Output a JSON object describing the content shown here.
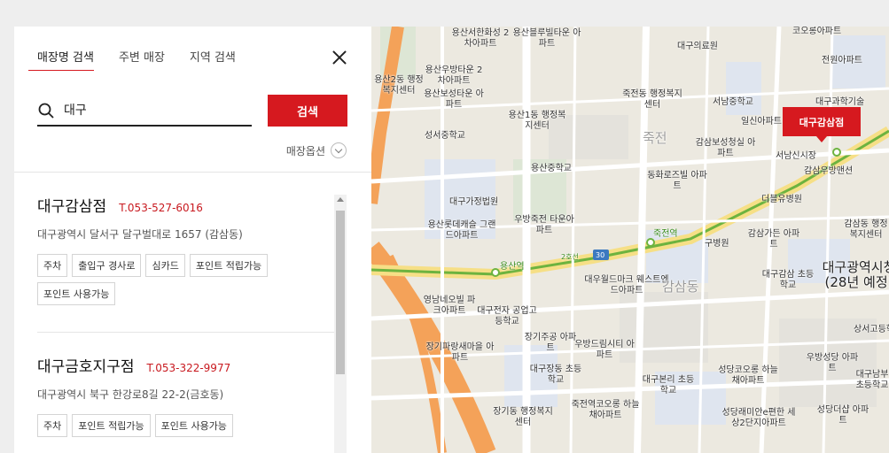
{
  "tabs": [
    {
      "label": "매장명 검색",
      "active": true
    },
    {
      "label": "주변 매장",
      "active": false
    },
    {
      "label": "지역 검색",
      "active": false
    }
  ],
  "search": {
    "value": "대구",
    "button_label": "검색"
  },
  "options": {
    "label": "매장옵션"
  },
  "stores": [
    {
      "name": "대구감삼점",
      "phone": "T.053-527-6016",
      "address": "대구광역시 달서구 달구벌대로 1657 (감삼동)",
      "tags": [
        "주차",
        "출입구 경사로",
        "심카드",
        "포인트 적립가능",
        "포인트 사용가능"
      ]
    },
    {
      "name": "대구금호지구점",
      "phone": "T.053-322-9977",
      "address": "대구광역시 북구 한강로8길 22-2(금호동)",
      "tags": [
        "주차",
        "포인트 적립가능",
        "포인트 사용가능"
      ]
    }
  ],
  "map": {
    "marker_label": "대구감삼점",
    "labels": [
      "용산서한화성 2차아파트",
      "용산블루빌타운 아파트",
      "대구의료원",
      "용산2동 행정복지센터",
      "용산우방타운 2차아파트",
      "용산보성타운 아파트",
      "성서중학교",
      "용산1동 행정복지센터",
      "죽전동 행정복지센터",
      "서남중학교",
      "대구과학기술",
      "일신아파트",
      "전원아파트",
      "코오롱아파트",
      "감삼보성청실 아파트",
      "서남신시장",
      "감삼우방맨션",
      "동화로즈빌 아파트",
      "더블유병원",
      "대구가정법원",
      "용산중학교",
      "우방죽전 타운아파트",
      "용산롯데캐슬 그랜드아파트",
      "용산역",
      "죽전역",
      "구병원",
      "감삼가든 아파트",
      "대구감삼 초등학교",
      "대구광역시청 (28년 예정)",
      "감삼동 행정복지센터",
      "대우월드마크 웨스트엔드아파트",
      "영남네오빌 파크아파트",
      "대구전자 공업고등학교",
      "감삼동",
      "장기파랑새마을 아파트",
      "장기주공 아파트",
      "우방드림시티 아파트",
      "대구장동 초등학교",
      "대구본리 초등학교",
      "성당코오롱 하늘채아파트",
      "우방성당 아파트",
      "대구남부 초등학교",
      "상서고등학교",
      "장기동 행정복지센터",
      "죽전역코오롱 하늘채아파트",
      "성당래미안e편한 세상2단지아파트",
      "성당더샵 아파트",
      "2호선",
      "30",
      "죽전"
    ]
  },
  "colors": {
    "accent": "#d6191f",
    "road_orange": "#f4a259",
    "metro_green": "#6db33f",
    "road_yellow": "#f6df86"
  }
}
